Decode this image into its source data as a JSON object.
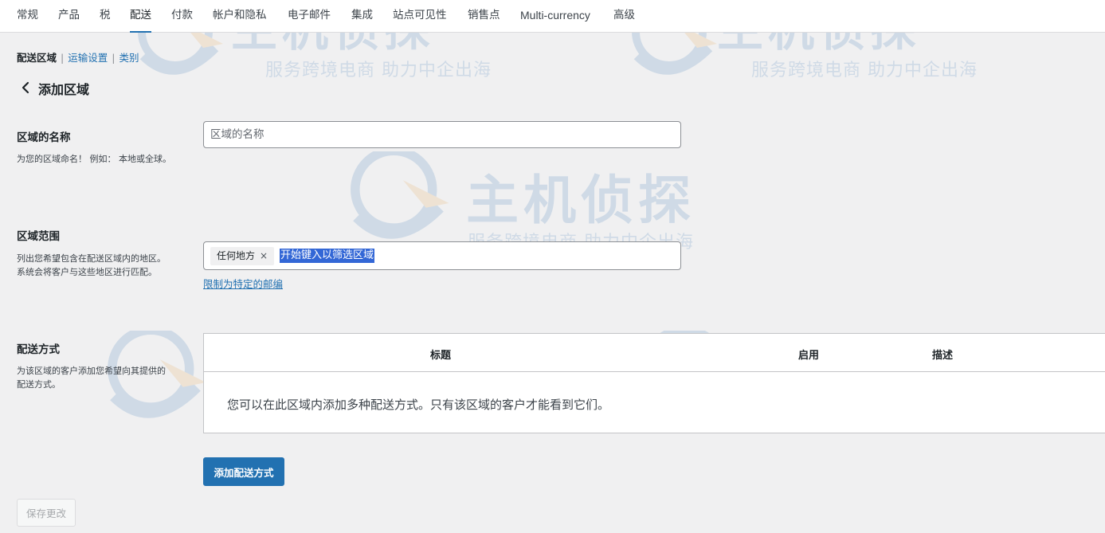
{
  "tabs": [
    "常规",
    "产品",
    "税",
    "配送",
    "付款",
    "帐户和隐私",
    "电子邮件",
    "集成",
    "站点可见性",
    "销售点",
    "Multi-currency",
    "高级"
  ],
  "active_tab": "配送",
  "subnav": {
    "current": "配送区域",
    "link1": "运输设置",
    "link2": "类别",
    "separator": "|"
  },
  "page_title": "添加区域",
  "zone_name": {
    "label": "区域的名称",
    "description": "为您的区域命名！ 例如： 本地或全球。",
    "placeholder": "区域的名称",
    "value": ""
  },
  "zone_regions": {
    "label": "区域范围",
    "description": "列出您希望包含在配送区域内的地区。 系统会将客户与这些地区进行匹配。",
    "chip": "任何地方",
    "chip_remove": "×",
    "search_placeholder": "开始键入以筛选区域",
    "postcode_link": "限制为特定的邮编"
  },
  "shipping_methods": {
    "label": "配送方式",
    "description": "为该区域的客户添加您希望向其提供的配送方式。",
    "columns": [
      "标题",
      "启用",
      "描述"
    ],
    "empty_message": "您可以在此区域内添加多种配送方式。只有该区域的客户才能看到它们。",
    "add_button": "添加配送方式"
  },
  "save_button": "保存更改",
  "watermark": {
    "main": "主机侦探",
    "sub": "服务跨境电商 助力中企出海"
  },
  "colors": {
    "accent": "#2271b1",
    "background": "#f0f0f1",
    "selection": "#3367d6"
  }
}
